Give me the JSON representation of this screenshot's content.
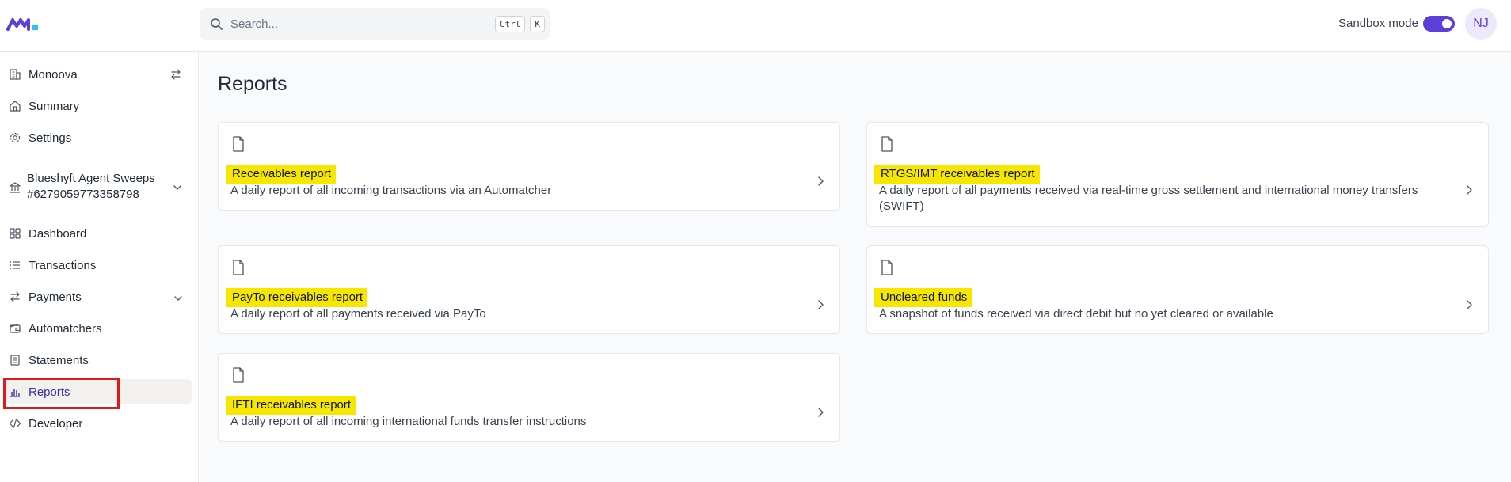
{
  "header": {
    "search_placeholder": "Search...",
    "shortcut_ctrl": "Ctrl",
    "shortcut_key": "K",
    "sandbox_label": "Sandbox mode",
    "sandbox_enabled": true,
    "avatar_initials": "NJ"
  },
  "sidebar": {
    "org": "Monoova",
    "summary": "Summary",
    "settings": "Settings",
    "account_name": "Blueshyft Agent Sweeps",
    "account_number": "#6279059773358798",
    "dashboard": "Dashboard",
    "transactions": "Transactions",
    "payments": "Payments",
    "automatchers": "Automatchers",
    "statements": "Statements",
    "reports": "Reports",
    "developer": "Developer"
  },
  "main": {
    "page_title": "Reports",
    "reports": [
      {
        "title": "Receivables report",
        "description": "A daily report of all incoming transactions via an Automatcher"
      },
      {
        "title": "RTGS/IMT receivables report",
        "description": "A daily report of all payments received via real-time gross settlement and international money transfers (SWIFT)"
      },
      {
        "title": "PayTo receivables report",
        "description": "A daily report of all payments received via PayTo"
      },
      {
        "title": "Uncleared funds",
        "description": "A snapshot of funds received via direct debit but no yet cleared or available"
      },
      {
        "title": "IFTI receivables report",
        "description": "A daily report of all incoming international funds transfer instructions"
      }
    ]
  },
  "colors": {
    "accent": "#5b3fd6",
    "highlight": "#f7e600",
    "annotation_box": "#e01919"
  }
}
